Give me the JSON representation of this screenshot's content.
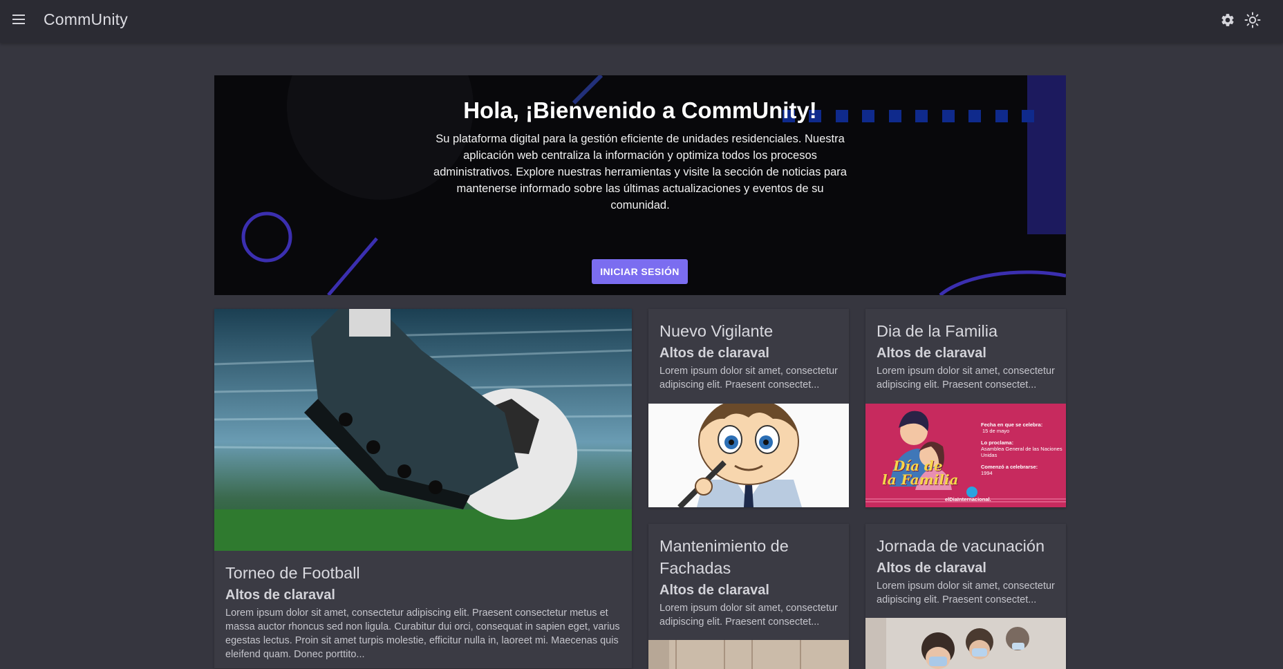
{
  "app": {
    "title": "CommUnity"
  },
  "topbar": {
    "menu_icon": "menu-icon",
    "settings_icon": "gear-icon",
    "theme_icon": "sun-icon"
  },
  "hero": {
    "title": "Hola, ¡Bienvenido a CommUnity!",
    "description": "Su plataforma digital para la gestión eficiente de unidades residenciales. Nuestra aplicación web centraliza la información y optimiza todos los procesos administrativos. Explore nuestras herramientas y visite la sección de noticias para mantenerse informado sobre las últimas actualizaciones y eventos de su comunidad.",
    "login_label": "INICIAR SESIÓN"
  },
  "news": [
    {
      "title": "Torneo de Football",
      "community": "Altos de claraval",
      "excerpt": "Lorem ipsum dolor sit amet, consectetur adipiscing elit. Praesent consectetur metus et massa auctor rhoncus sed non ligula. Curabitur dui orci, consequat in sapien eget, varius egestas lectus. Proin sit amet turpis molestie, efficitur nulla in, laoreet mi. Maecenas quis eleifend quam. Donec porttito..."
    },
    {
      "title": "Nuevo Vigilante",
      "community": "Altos de claraval",
      "excerpt": "Lorem ipsum dolor sit amet, consectetur adipiscing elit. Praesent consectet..."
    },
    {
      "title": "Dia de la Familia",
      "community": "Altos de claraval",
      "excerpt": "Lorem ipsum dolor sit amet, consectetur adipiscing elit. Praesent consectet...",
      "poster": {
        "headline_1": "Día de",
        "headline_2": "la Familia",
        "info_1_label": "Fecha en que se celebra:",
        "info_1_value": "15 de mayo",
        "info_2_label": "Lo proclama:",
        "info_2_value": "Asamblea General de las Naciones Unidas",
        "info_3_label": "Comenzó a celebrarse:",
        "info_3_value": "1994",
        "brand": "elDiaInternacional."
      }
    },
    {
      "title": "Mantenimiento de Fachadas",
      "community": "Altos de claraval",
      "excerpt": "Lorem ipsum dolor sit amet, consectetur adipiscing elit. Praesent consectet..."
    },
    {
      "title": "Jornada de vacunación",
      "community": "Altos de claraval",
      "excerpt": "Lorem ipsum dolor sit amet, consectetur adipiscing elit. Praesent consectet..."
    }
  ],
  "colors": {
    "background": "#36363f",
    "appbar": "#2b2b33",
    "card": "#3b3b44",
    "accent": "#7b6df0",
    "hero": "#08080b"
  }
}
